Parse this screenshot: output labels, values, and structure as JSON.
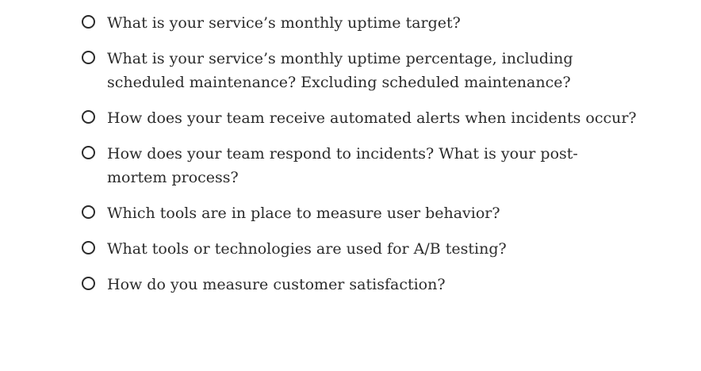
{
  "checklist": {
    "items": [
      {
        "label": "What is your service’s monthly uptime target?"
      },
      {
        "label": "What is your service’s monthly uptime percentage, including\nscheduled maintenance? Excluding scheduled maintenance?"
      },
      {
        "label": "How does your team receive automated alerts when incidents occur?"
      },
      {
        "label": "How does your team respond to incidents? What is your post-\nmortem process?"
      },
      {
        "label": "Which tools are in place to measure user behavior?"
      },
      {
        "label": "What tools or technologies are used for A/B testing?"
      },
      {
        "label": "How do you measure customer satisfaction?"
      }
    ]
  }
}
